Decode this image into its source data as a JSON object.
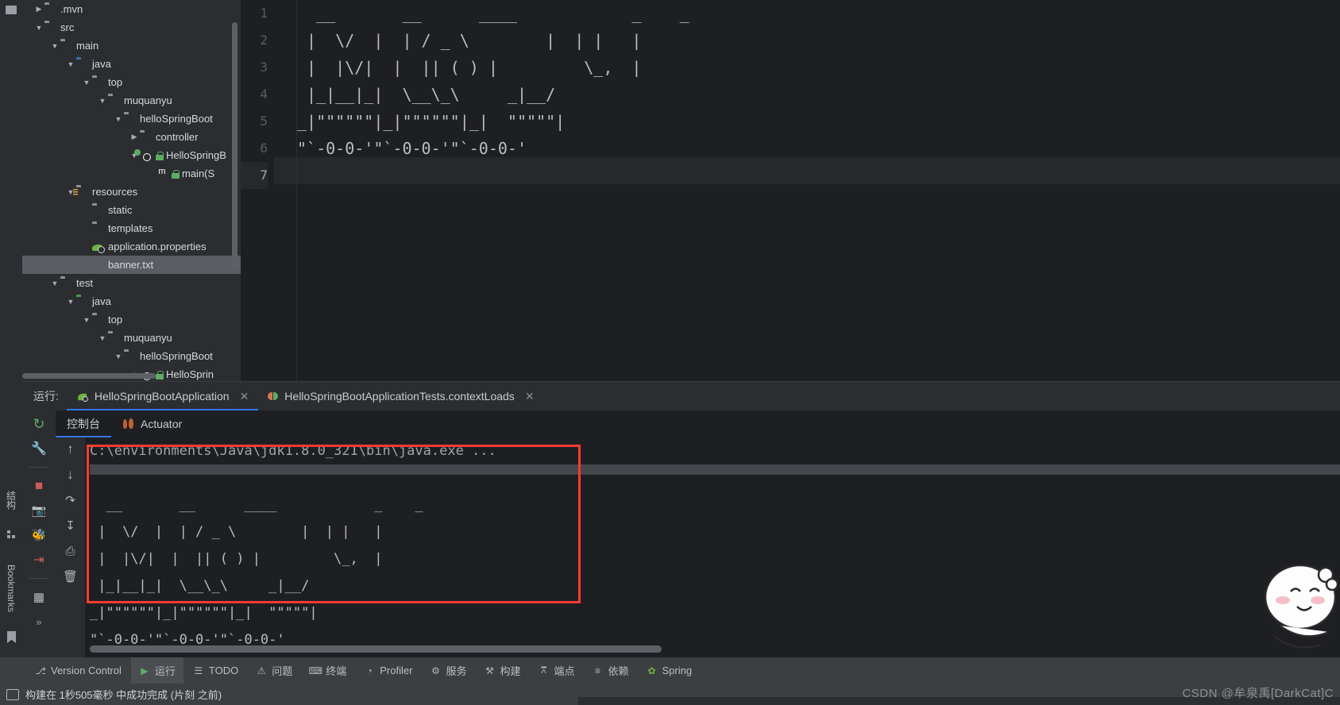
{
  "app": {
    "theme_bg": "#1e1f22",
    "accent": "#3574f0",
    "highlight_red": "#ff3b30"
  },
  "left_rail": {
    "top_icon": "folder-icon",
    "structure_label": "结构",
    "bookmarks_label": "Bookmarks",
    "bookmark_icon": "bookmark-icon",
    "structure_icon": "structure-icon"
  },
  "project_tree": {
    "items": [
      {
        "label": ".mvn",
        "indent": 1,
        "arrow": "collapsed",
        "icon": "folder-icon",
        "selected": "none"
      },
      {
        "label": "src",
        "indent": 1,
        "arrow": "expanded",
        "icon": "folder-icon",
        "selected": "none"
      },
      {
        "label": "main",
        "indent": 2,
        "arrow": "expanded",
        "icon": "folder-icon",
        "selected": "none"
      },
      {
        "label": "java",
        "indent": 3,
        "arrow": "expanded",
        "icon": "folder-blue-icon",
        "selected": "none"
      },
      {
        "label": "top",
        "indent": 4,
        "arrow": "expanded",
        "icon": "package-icon",
        "selected": "none"
      },
      {
        "label": "muquanyu",
        "indent": 5,
        "arrow": "expanded",
        "icon": "package-icon",
        "selected": "none"
      },
      {
        "label": "helloSpringBoot",
        "indent": 6,
        "arrow": "expanded",
        "icon": "package-icon",
        "selected": "none"
      },
      {
        "label": "controller",
        "indent": 7,
        "arrow": "collapsed",
        "icon": "package-icon",
        "selected": "none"
      },
      {
        "label": "HelloSpringB",
        "indent": 7,
        "arrow": "expanded",
        "icon": "spring-class-icon",
        "selected": "none"
      },
      {
        "label": "main(S",
        "indent": 8,
        "arrow": "none",
        "icon": "method-icon",
        "selected": "none"
      },
      {
        "label": "resources",
        "indent": 3,
        "arrow": "expanded",
        "icon": "resources-folder-icon",
        "selected": "none"
      },
      {
        "label": "static",
        "indent": 4,
        "arrow": "none",
        "icon": "folder-icon",
        "selected": "none"
      },
      {
        "label": "templates",
        "indent": 4,
        "arrow": "none",
        "icon": "folder-icon",
        "selected": "none"
      },
      {
        "label": "application.properties",
        "indent": 4,
        "arrow": "none",
        "icon": "spring-properties-icon",
        "selected": "none"
      },
      {
        "label": "banner.txt",
        "indent": 4,
        "arrow": "none",
        "icon": "text-file-icon",
        "selected": "blur"
      },
      {
        "label": "test",
        "indent": 2,
        "arrow": "expanded",
        "icon": "folder-icon",
        "selected": "none"
      },
      {
        "label": "java",
        "indent": 3,
        "arrow": "expanded",
        "icon": "folder-green-icon",
        "selected": "none"
      },
      {
        "label": "top",
        "indent": 4,
        "arrow": "expanded",
        "icon": "package-icon",
        "selected": "none"
      },
      {
        "label": "muquanyu",
        "indent": 5,
        "arrow": "expanded",
        "icon": "package-icon",
        "selected": "none"
      },
      {
        "label": "helloSpringBoot",
        "indent": 6,
        "arrow": "expanded",
        "icon": "package-icon",
        "selected": "none"
      },
      {
        "label": "HelloSprin",
        "indent": 7,
        "arrow": "expanded",
        "icon": "test-class-icon",
        "selected": "none"
      }
    ]
  },
  "editor": {
    "line_numbers": [
      "1",
      "2",
      "3",
      "4",
      "5",
      "6",
      "7"
    ],
    "current_line": "7",
    "lines": [
      "  __       __      ____            _    _",
      " |  \\/  |  | / _ \\        |  | |   |",
      " |  |\\/|  |  || ( ) |         \\_,  |",
      " |_|__|_|  \\__\\_\\     _|__/",
      "_|\"\"\"\"\"\"|_|\"\"\"\"\"\"|_|  \"\"\"\"\"|",
      "\"`-0-0-'\"`-0-0-'\"`-0-0-'",
      ""
    ]
  },
  "run_panel": {
    "run_label": "运行:",
    "tabs": [
      {
        "label": "HelloSpringBootApplication",
        "icon": "spring-icon",
        "active": true,
        "closable": true
      },
      {
        "label": "HelloSpringBootApplicationTests.contextLoads",
        "icon": "junit-icon",
        "active": false,
        "closable": true
      }
    ],
    "sub_tabs": [
      {
        "label": "控制台",
        "icon": "console-icon",
        "active": true
      },
      {
        "label": "Actuator",
        "icon": "flame-icon",
        "active": false
      }
    ],
    "toolbar_left": [
      {
        "name": "rerun-icon",
        "glyph": "↻",
        "color": "#5fad65"
      },
      {
        "name": "settings-wrench-icon",
        "glyph": "🔧",
        "color": "#b2b6bc"
      },
      {
        "name": "stop-icon",
        "glyph": "■",
        "color": "#cc5b5b"
      },
      {
        "name": "camera-icon",
        "glyph": "◉",
        "color": "#b2b6bc"
      },
      {
        "name": "debug-icon",
        "glyph": "🐞",
        "color": "#5fad65"
      },
      {
        "name": "exit-icon",
        "glyph": "→",
        "color": "#cc5b5b"
      },
      {
        "name": "layout-icon",
        "glyph": "▤",
        "color": "#b2b6bc"
      },
      {
        "name": "more-icon",
        "glyph": "»",
        "color": "#b2b6bc"
      }
    ],
    "toolbar_console": [
      {
        "name": "scroll-up-icon",
        "glyph": "↑"
      },
      {
        "name": "scroll-down-icon",
        "glyph": "↓"
      },
      {
        "name": "soft-wrap-icon",
        "glyph": "↩"
      },
      {
        "name": "scroll-to-end-icon",
        "glyph": "↧"
      },
      {
        "name": "print-icon",
        "glyph": "⎙"
      },
      {
        "name": "clear-all-icon",
        "glyph": "🗑"
      }
    ],
    "console_lines": [
      "C:\\environments\\Java\\jdk1.8.0_321\\bin\\java.exe ...",
      "",
      "  __       __      ____            _    _",
      " |  \\/  |  | / _ \\        |  | |   |",
      " |  |\\/|  |  || ( ) |         \\_,  |",
      " |_|__|_|  \\__\\_\\     _|__/",
      "_|\"\"\"\"\"\"|_|\"\"\"\"\"\"|_|  \"\"\"\"\"|",
      "\"`-0-0-'\"`-0-0-'\"`-0-0-'"
    ]
  },
  "bottom_nav": {
    "items": [
      {
        "label": "Version Control",
        "icon": "branch-icon",
        "active": false
      },
      {
        "label": "运行",
        "icon": "play-icon",
        "active": true
      },
      {
        "label": "TODO",
        "icon": "todo-icon",
        "active": false
      },
      {
        "label": "问题",
        "icon": "warning-icon",
        "active": false
      },
      {
        "label": "终端",
        "icon": "terminal-icon",
        "active": false
      },
      {
        "label": "Profiler",
        "icon": "profiler-icon",
        "active": false
      },
      {
        "label": "服务",
        "icon": "services-icon",
        "active": false
      },
      {
        "label": "构建",
        "icon": "build-icon",
        "active": false
      },
      {
        "label": "端点",
        "icon": "endpoints-icon",
        "active": false
      },
      {
        "label": "依赖",
        "icon": "dependencies-icon",
        "active": false
      },
      {
        "label": "Spring",
        "icon": "spring-leaf-icon",
        "active": false
      }
    ]
  },
  "status_bar": {
    "icon": "build-status-icon",
    "text": "构建在 1秒505毫秒 中成功完成 (片刻 之前)"
  },
  "watermark": {
    "text": "CSDN @牟泉禹[DarkCat]C"
  }
}
